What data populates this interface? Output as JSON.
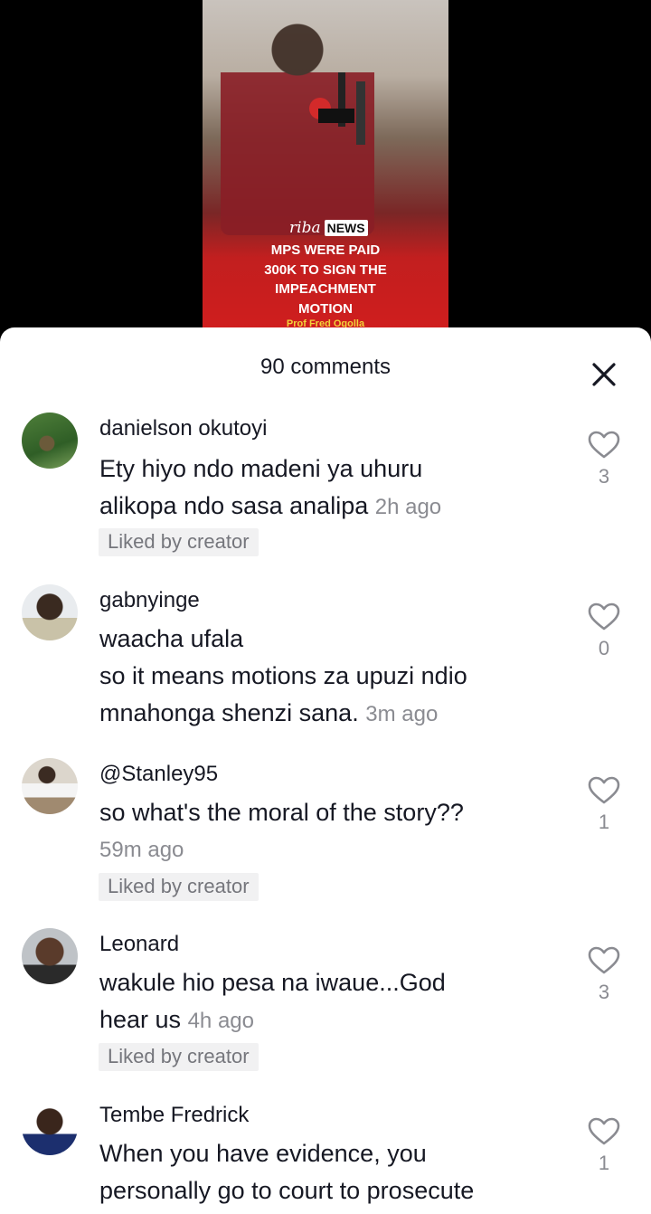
{
  "video": {
    "logo_text": "riba",
    "news_text": "NEWS",
    "headline_lines": [
      "MPS WERE PAID",
      "300K TO SIGN THE",
      "IMPEACHMENT",
      "MOTION"
    ],
    "credit": "Prof Fred Ogolla"
  },
  "comments_sheet": {
    "title": "90 comments",
    "close_icon": "close-icon"
  },
  "comments": [
    {
      "username": "danielson okutoyi",
      "text_lines": [
        "Ety hiyo ndo madeni ya uhuru",
        "alikopa ndo sasa analipa"
      ],
      "time": "2h ago",
      "liked_by_creator": "Liked by creator",
      "likes": "3"
    },
    {
      "username": "gabnyinge",
      "text_lines": [
        "waacha ufala",
        "so it means motions za upuzi ndio",
        "mnahonga shenzi sana."
      ],
      "time": "3m ago",
      "liked_by_creator": "",
      "likes": "0"
    },
    {
      "username": "@Stanley95",
      "text_lines": [
        "so what's the moral of the story??"
      ],
      "time": "59m ago",
      "liked_by_creator": "Liked by creator",
      "likes": "1"
    },
    {
      "username": "Leonard",
      "text_lines": [
        "wakule hio pesa na iwaue...God",
        "hear us"
      ],
      "time": "4h ago",
      "liked_by_creator": "Liked by creator",
      "likes": "3"
    },
    {
      "username": "Tembe Fredrick",
      "text_lines": [
        "When you have evidence, you",
        "personally go to court to prosecute"
      ],
      "time": "",
      "liked_by_creator": "",
      "likes": "1"
    }
  ]
}
